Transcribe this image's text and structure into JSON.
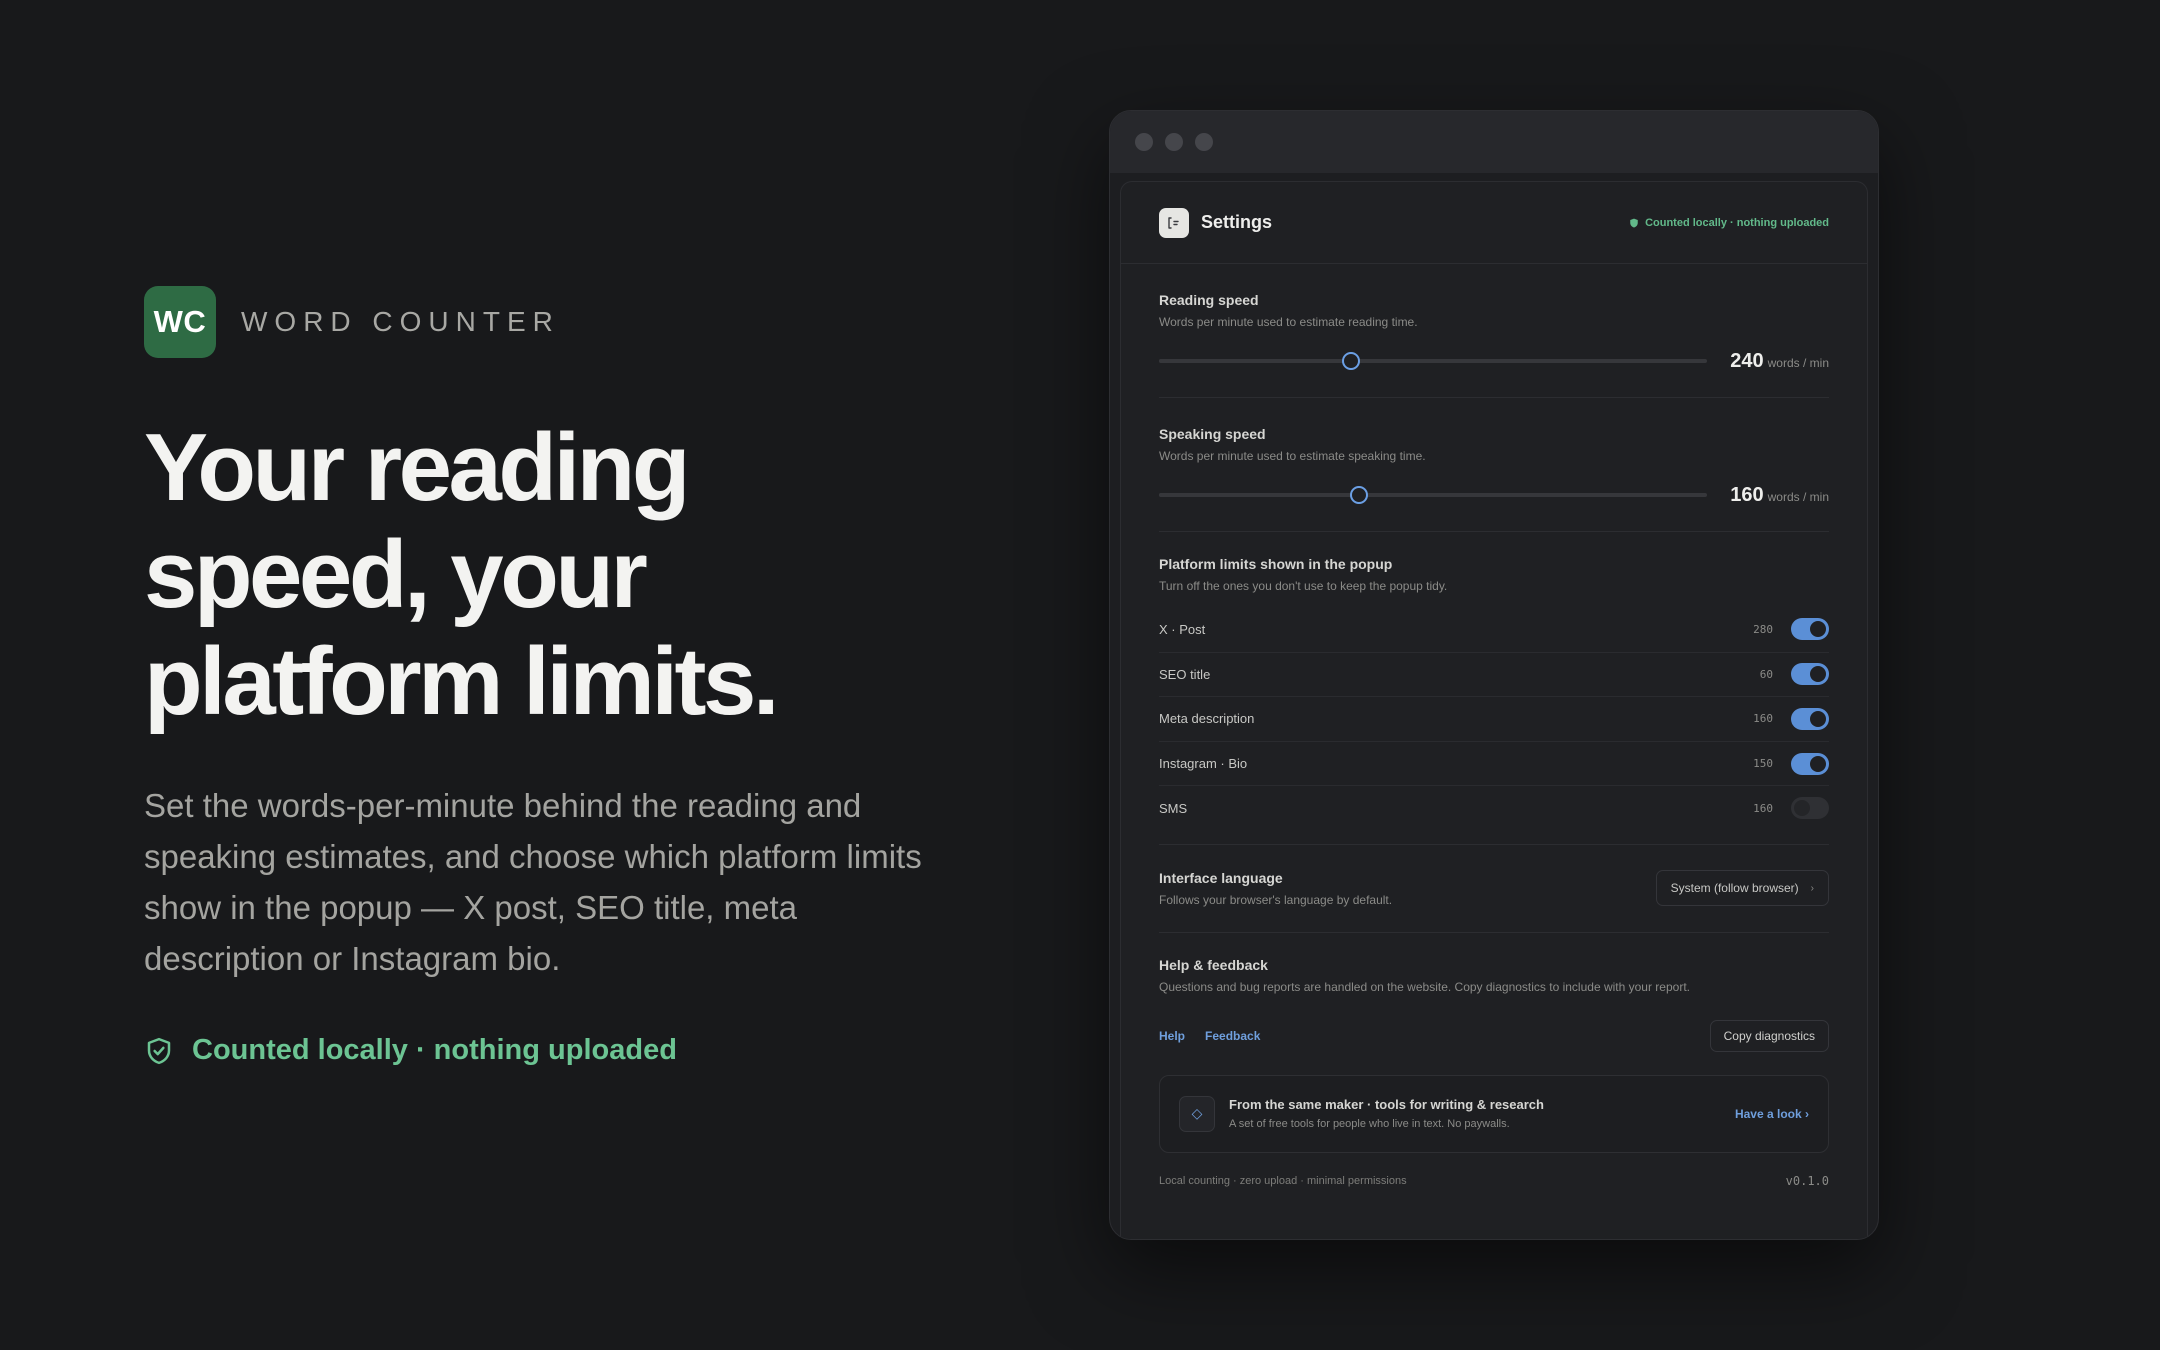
{
  "hero": {
    "logo_text": "WC",
    "brand_name": "WORD COUNTER",
    "title_line1": "Your reading",
    "title_line2": "speed, your",
    "title_line3": "platform limits.",
    "description": "Set the words-per-minute behind the reading and speaking estimates, and choose which platform limits show in the popup — X post, SEO title, meta description or Instagram bio.",
    "badge": "Counted locally · nothing uploaded",
    "badge_color": "#6cc493",
    "logo_color": "#2e6b44"
  },
  "window": {
    "header": {
      "title": "Settings",
      "icon": "settings-panel-icon",
      "badge": "Counted locally · nothing uploaded"
    },
    "reading_speed": {
      "title": "Reading speed",
      "description": "Words per minute used to estimate reading time.",
      "value": "240",
      "unit": "words / min",
      "slider_fraction": 0.35
    },
    "speaking_speed": {
      "title": "Speaking speed",
      "description": "Words per minute used to estimate speaking time.",
      "value": "160",
      "unit": "words / min",
      "slider_fraction": 0.365
    },
    "limits": {
      "title": "Platform limits shown in the popup",
      "description": "Turn off the ones you don't use to keep the popup tidy.",
      "items": [
        {
          "label": "X · Post",
          "limit": "280",
          "enabled": true
        },
        {
          "label": "SEO title",
          "limit": "60",
          "enabled": true
        },
        {
          "label": "Meta description",
          "limit": "160",
          "enabled": true
        },
        {
          "label": "Instagram · Bio",
          "limit": "150",
          "enabled": true
        },
        {
          "label": "SMS",
          "limit": "160",
          "enabled": false
        }
      ]
    },
    "language": {
      "title": "Interface language",
      "description": "Follows your browser's language by default.",
      "selected": "System (follow browser)"
    },
    "help": {
      "title": "Help & feedback",
      "description": "Questions and bug reports are handled on the website. Copy diagnostics to include with your report.",
      "help_link": "Help",
      "feedback_link": "Feedback",
      "copy_button": "Copy diagnostics"
    },
    "promo": {
      "title": "From the same maker · tools for writing & research",
      "description": "A set of free tools for people who live in text. No paywalls.",
      "link": "Have a look ›"
    },
    "footer": {
      "text": "Local counting · zero upload · minimal permissions",
      "version": "v0.1.0"
    },
    "accent_color": "#5b8fd6"
  }
}
